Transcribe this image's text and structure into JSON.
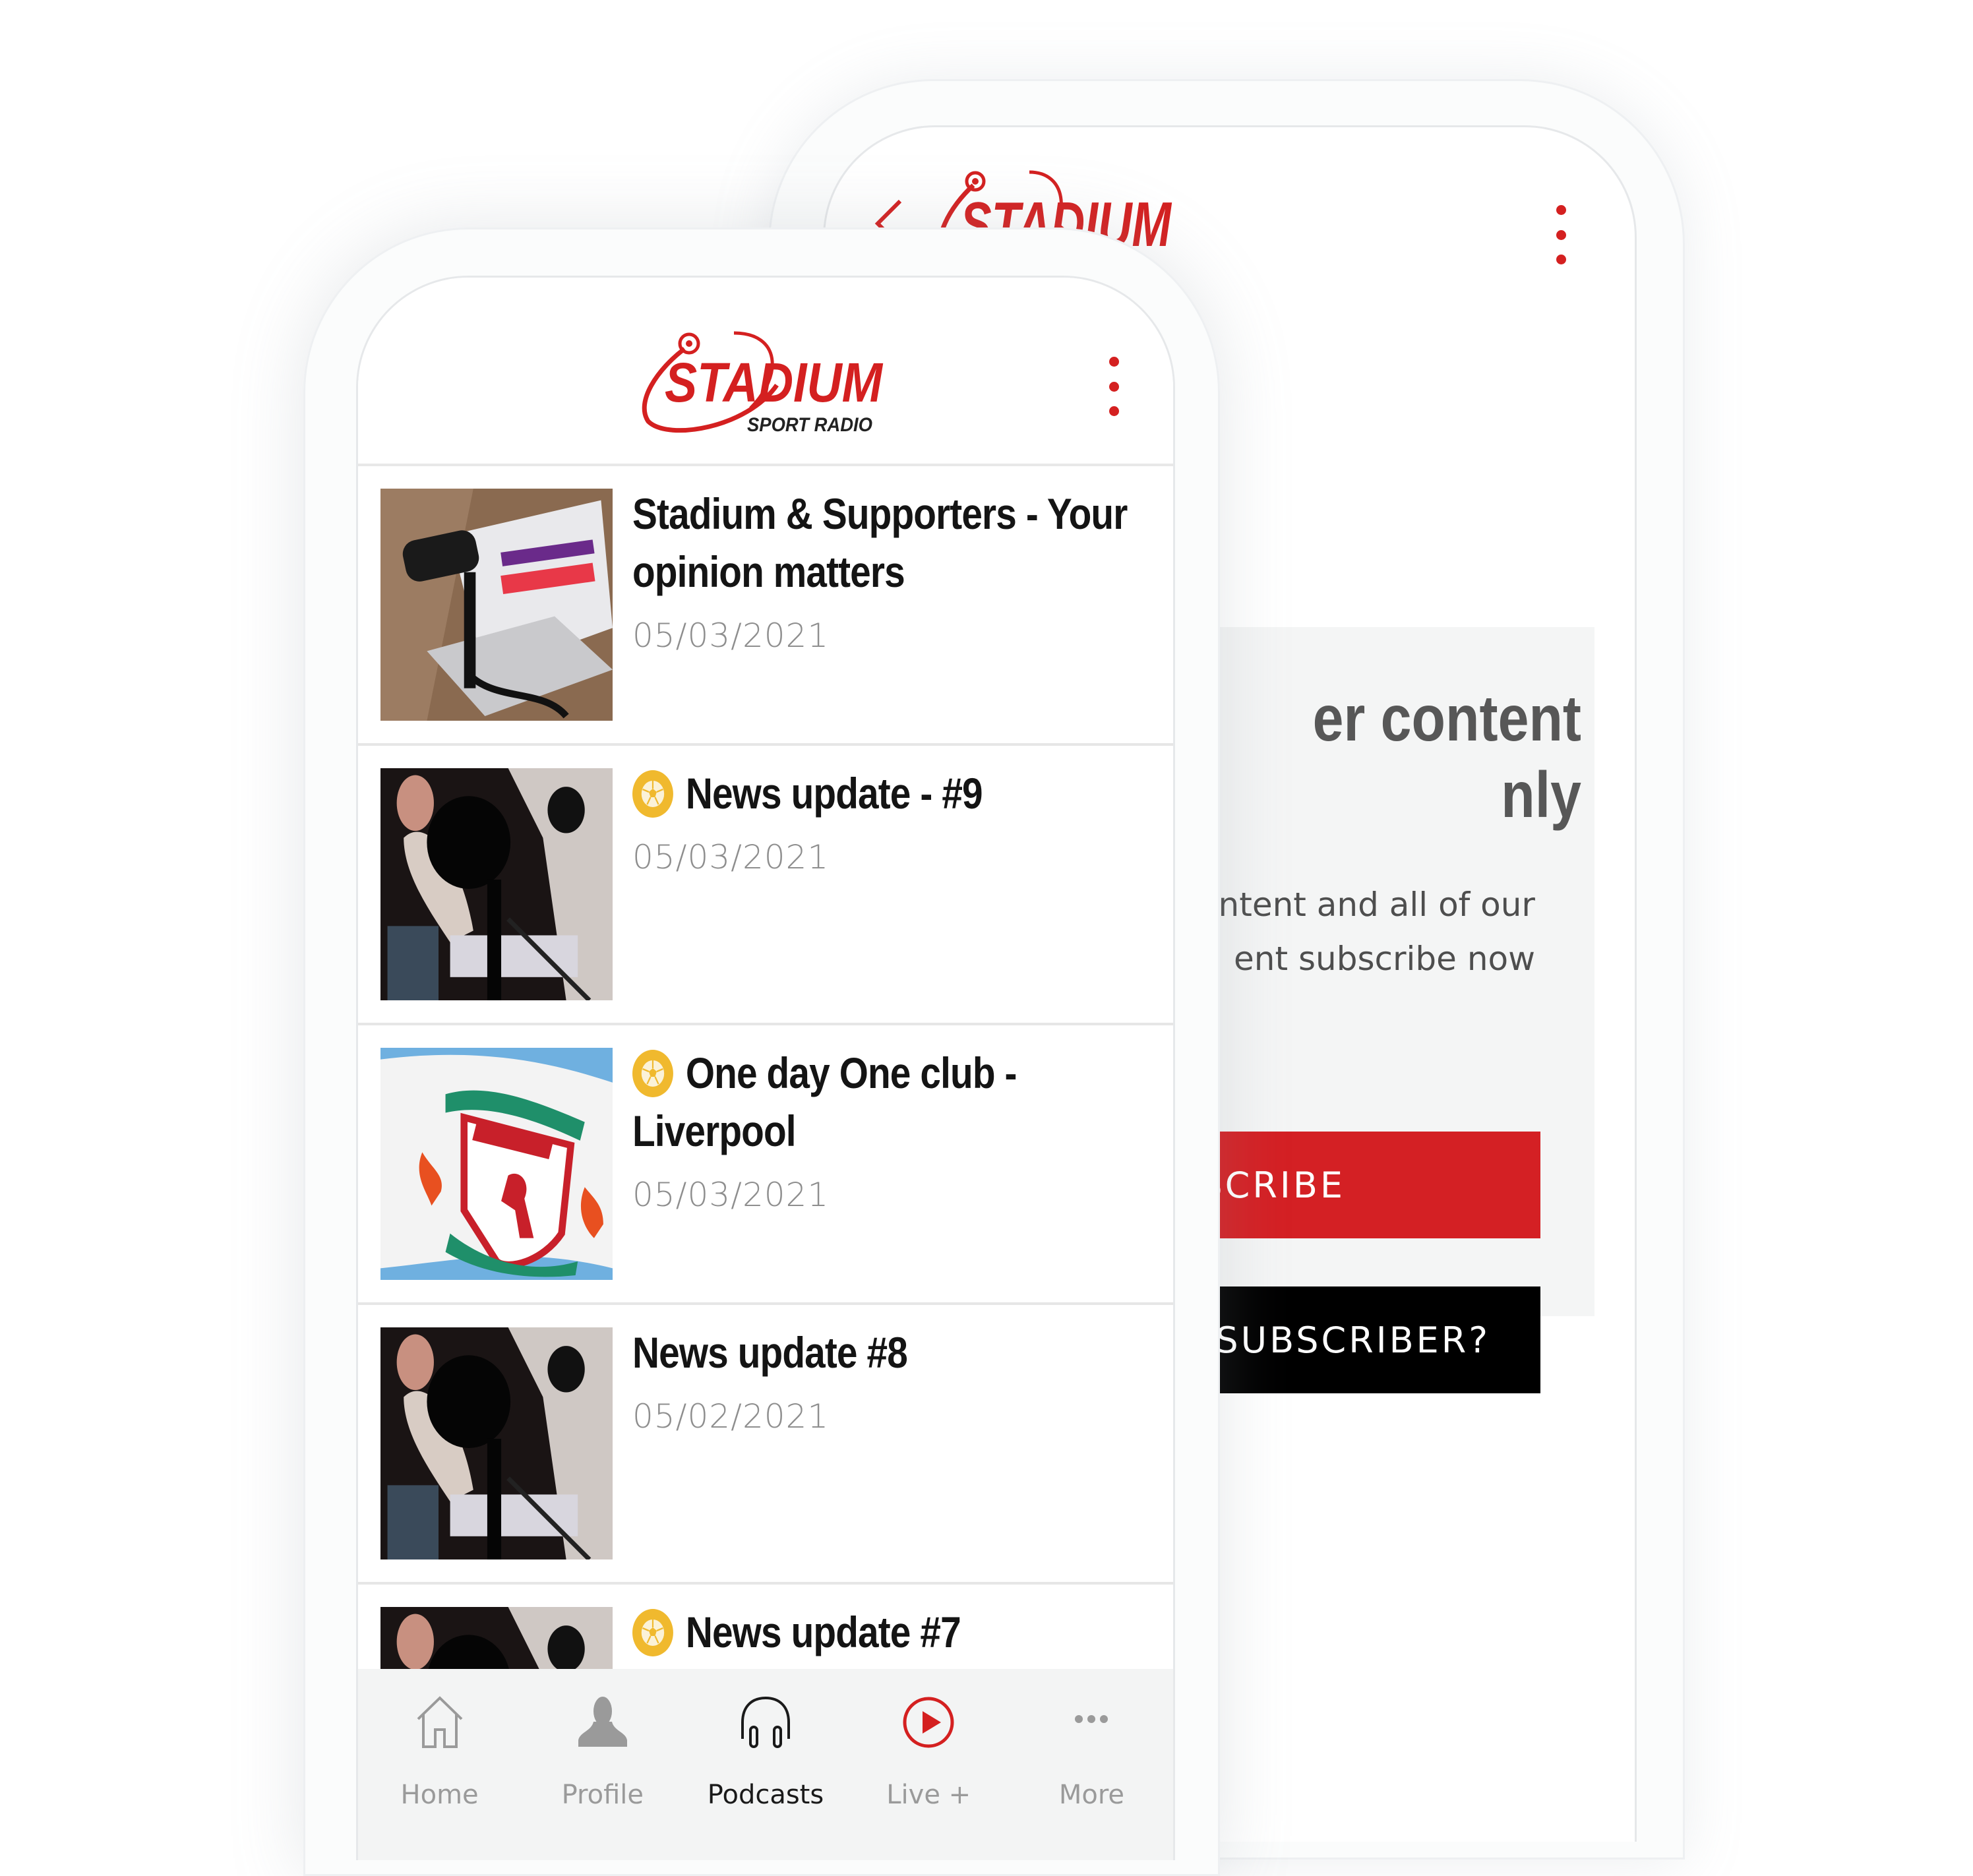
{
  "brand": {
    "name": "STADIUM",
    "tagline": "SPORT RADIO",
    "accent_color": "#d42020",
    "premium_color": "#f0b92e"
  },
  "front_screen": {
    "header": {
      "logo_alt": "Stadium Sport Radio",
      "menu_icon": "kebab-menu-icon"
    },
    "podcasts": [
      {
        "title": "Stadium & Supporters - Your opinion matters",
        "date": "05/03/2021",
        "premium": false,
        "thumbnail": "microphone-laptop"
      },
      {
        "title": "News update - #9",
        "date": "05/03/2021",
        "premium": true,
        "thumbnail": "studio-microphone"
      },
      {
        "title": "One day One club - Liverpool",
        "date": "05/03/2021",
        "premium": true,
        "thumbnail": "liverpool-flag"
      },
      {
        "title": "News update #8",
        "date": "05/02/2021",
        "premium": false,
        "thumbnail": "studio-microphone"
      },
      {
        "title": "News update #7",
        "date": "",
        "premium": true,
        "thumbnail": "studio-microphone"
      }
    ],
    "bottom_nav": [
      {
        "label": "Home",
        "icon": "home-icon",
        "active": false
      },
      {
        "label": "Profile",
        "icon": "profile-icon",
        "active": false
      },
      {
        "label": "Podcasts",
        "icon": "headphones-icon",
        "active": true
      },
      {
        "label": "Live +",
        "icon": "play-circle-icon",
        "active": false
      },
      {
        "label": "More",
        "icon": "more-icon",
        "active": false
      }
    ]
  },
  "back_screen": {
    "header": {
      "back_icon": "chevron-left-icon",
      "menu_icon": "kebab-menu-icon"
    },
    "paywall": {
      "title_visible": "er content\nnly",
      "text_visible": "ntent and all of our\nent subscribe now",
      "subscribe_label_visible": "SCRIBE",
      "already_subscriber_label_visible": "SUBSCRIBER?"
    }
  }
}
